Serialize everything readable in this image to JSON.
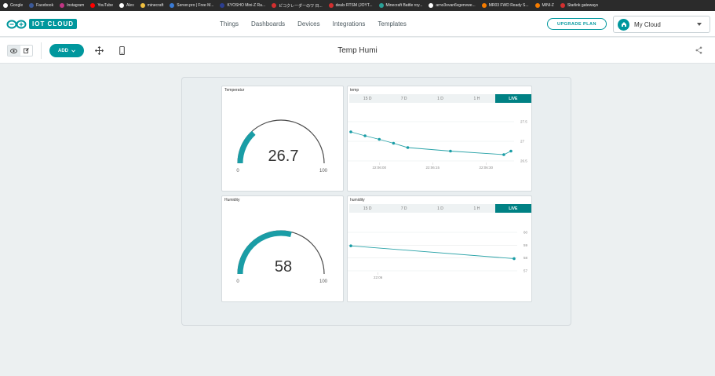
{
  "bookmarks": [
    {
      "label": "Google",
      "color": "#ffffff"
    },
    {
      "label": "Facebook",
      "color": "#3b5998"
    },
    {
      "label": "Instagram",
      "color": "#c13584"
    },
    {
      "label": "YouTube",
      "color": "#ff0000"
    },
    {
      "label": "Alex",
      "color": "#ffffff"
    },
    {
      "label": "minecraft",
      "color": "#f0c040"
    },
    {
      "label": "Server.pro | Free M...",
      "color": "#3a7bd5"
    },
    {
      "label": "KYOSHO Mini-Z Ra...",
      "color": "#2c3e90"
    },
    {
      "label": "ピコクレーダーのワ 日...",
      "color": "#d32f2f"
    },
    {
      "label": "dealx RTSM (JOYT...",
      "color": "#d32f2f"
    },
    {
      "label": "Minecraft Battle roy...",
      "color": "#2aa198"
    },
    {
      "label": "arno3ovan6vgenvwe...",
      "color": "#ffffff"
    },
    {
      "label": "MR03 FWD Ready S...",
      "color": "#f57c00"
    },
    {
      "label": "MINI-Z",
      "color": "#f57c00"
    },
    {
      "label": "Starlink gateways",
      "color": "#d32f2f"
    }
  ],
  "header": {
    "logo_text": "IOT CLOUD",
    "nav": [
      "Things",
      "Dashboards",
      "Devices",
      "Integrations",
      "Templates"
    ],
    "upgrade_label": "UPGRADE PLAN",
    "cloud_label": "My Cloud"
  },
  "toolbar": {
    "add_label": "ADD",
    "dashboard_title": "Temp Humi"
  },
  "colors": {
    "accent": "#00979d",
    "live": "#008184"
  },
  "widgets": {
    "temp_gauge": {
      "title": "Temperatur",
      "value": "26.7",
      "min_label": "0",
      "max_label": "100",
      "min": 0,
      "max": 100,
      "level": 26.7
    },
    "temp_chart": {
      "title": "temp",
      "tabs": [
        "15 D",
        "7 D",
        "1 D",
        "1 H",
        "LIVE"
      ],
      "y_ticks": [
        "27.5",
        "27",
        "26.5"
      ],
      "x_ticks": [
        "22:06:00",
        "22:06:15",
        "22:06:30"
      ]
    },
    "humidity_gauge": {
      "title": "Humidity",
      "value": "58",
      "min_label": "0",
      "max_label": "100",
      "min": 0,
      "max": 100,
      "level": 58
    },
    "humidity_chart": {
      "title": "humidity",
      "tabs": [
        "15 D",
        "7 D",
        "1 D",
        "1 H",
        "LIVE"
      ],
      "y_ticks": [
        "60",
        "59",
        "58",
        "57"
      ],
      "x_ticks": [
        "22:06"
      ]
    }
  },
  "chart_data": [
    {
      "type": "line",
      "title": "temp",
      "xlabel": "",
      "ylabel": "",
      "x": [
        "22:05:52",
        "22:05:56",
        "22:06:00",
        "22:06:04",
        "22:06:08",
        "22:06:20",
        "22:06:35",
        "22:06:37"
      ],
      "series": [
        {
          "values": [
            27.24,
            27.14,
            27.05,
            26.95,
            26.84,
            26.75,
            26.66,
            26.75
          ]
        }
      ],
      "ylim": [
        26.5,
        27.5
      ],
      "x_ticks": [
        "22:06:00",
        "22:06:15",
        "22:06:30"
      ],
      "y_ticks": [
        26.5,
        27,
        27.5
      ],
      "grid": true
    },
    {
      "type": "line",
      "title": "humidity",
      "xlabel": "",
      "ylabel": "",
      "x": [
        "22:05:50",
        "22:06:50"
      ],
      "series": [
        {
          "values": [
            58.95,
            57.95
          ]
        }
      ],
      "ylim": [
        57,
        60
      ],
      "x_ticks": [
        "22:06"
      ],
      "y_ticks": [
        57,
        58,
        59,
        60
      ],
      "grid": true
    }
  ]
}
